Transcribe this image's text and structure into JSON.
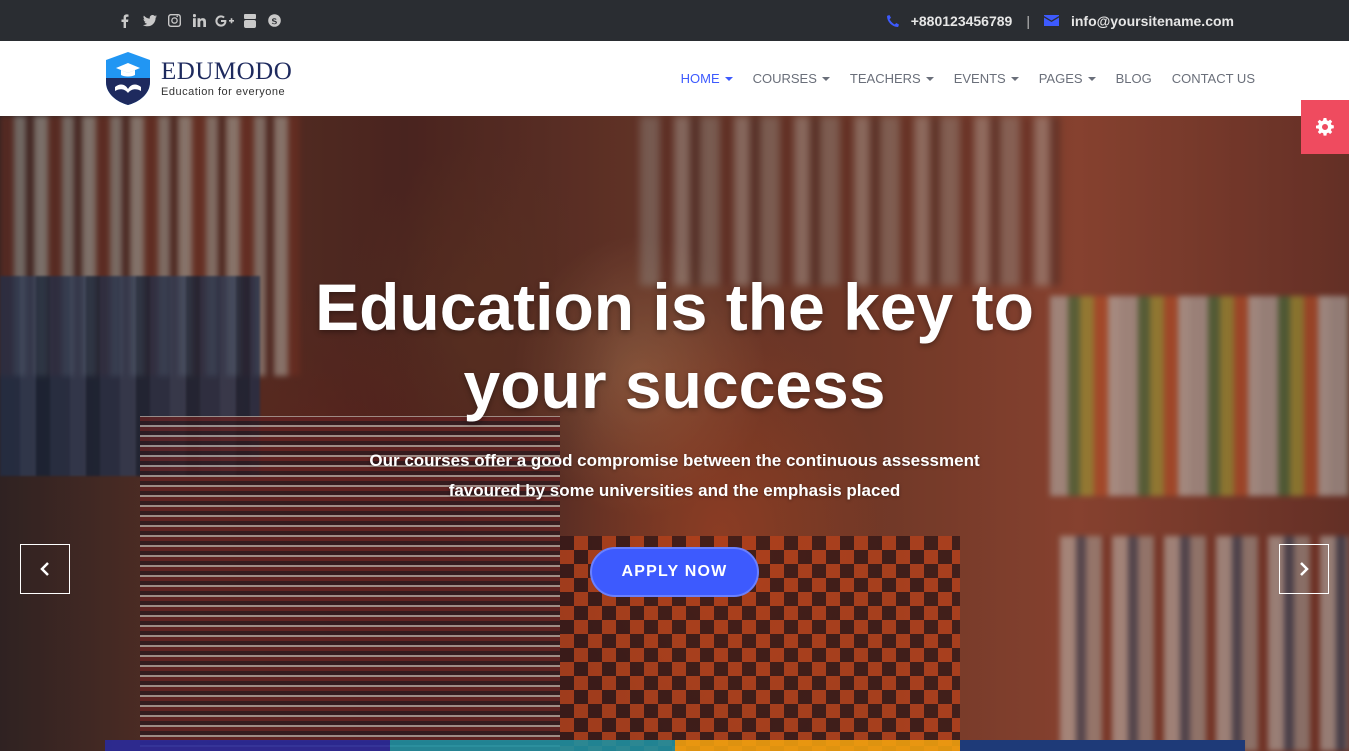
{
  "topbar": {
    "social": [
      {
        "name": "facebook-icon",
        "glyph": "f"
      },
      {
        "name": "twitter-icon",
        "glyph": "t"
      },
      {
        "name": "instagram-icon",
        "glyph": "i"
      },
      {
        "name": "linkedin-icon",
        "glyph": "in"
      },
      {
        "name": "google-plus-icon",
        "glyph": "G+"
      },
      {
        "name": "youtube-icon",
        "glyph": "yt"
      },
      {
        "name": "skype-icon",
        "glyph": "S"
      }
    ],
    "phone_icon": "phone-icon",
    "phone": "+880123456789",
    "separator": "|",
    "email_icon": "envelope-icon",
    "email": "info@yoursitename.com"
  },
  "header": {
    "logo_name": "EDUMODO",
    "logo_tagline": "Education for everyone",
    "nav": [
      {
        "label": "HOME",
        "dropdown": true,
        "active": true
      },
      {
        "label": "COURSES",
        "dropdown": true,
        "active": false
      },
      {
        "label": "TEACHERS",
        "dropdown": true,
        "active": false
      },
      {
        "label": "EVENTS",
        "dropdown": true,
        "active": false
      },
      {
        "label": "PAGES",
        "dropdown": true,
        "active": false
      },
      {
        "label": "BLOG",
        "dropdown": false,
        "active": false
      },
      {
        "label": "CONTACT US",
        "dropdown": false,
        "active": false
      }
    ]
  },
  "hero": {
    "title_line1": "Education is the key to",
    "title_line2": "your success",
    "subtitle_line1": "Our courses offer a good compromise between the continuous assessment",
    "subtitle_line2": "favoured by some universities and the emphasis placed",
    "cta_label": "APPLY NOW",
    "prev_icon": "chevron-left-icon",
    "next_icon": "chevron-right-icon"
  },
  "settings_icon": "gear-icon",
  "colors": {
    "accent": "#3d5afe",
    "topbar_bg": "#2a2d32",
    "settings_bg": "#ef4b5f",
    "logo_navy": "#1e2a5e",
    "nav_text": "#6a6f7a",
    "feature_strip": [
      "#2a2a9a",
      "#1f8fa0",
      "#f0a010",
      "#1e3a78"
    ]
  }
}
